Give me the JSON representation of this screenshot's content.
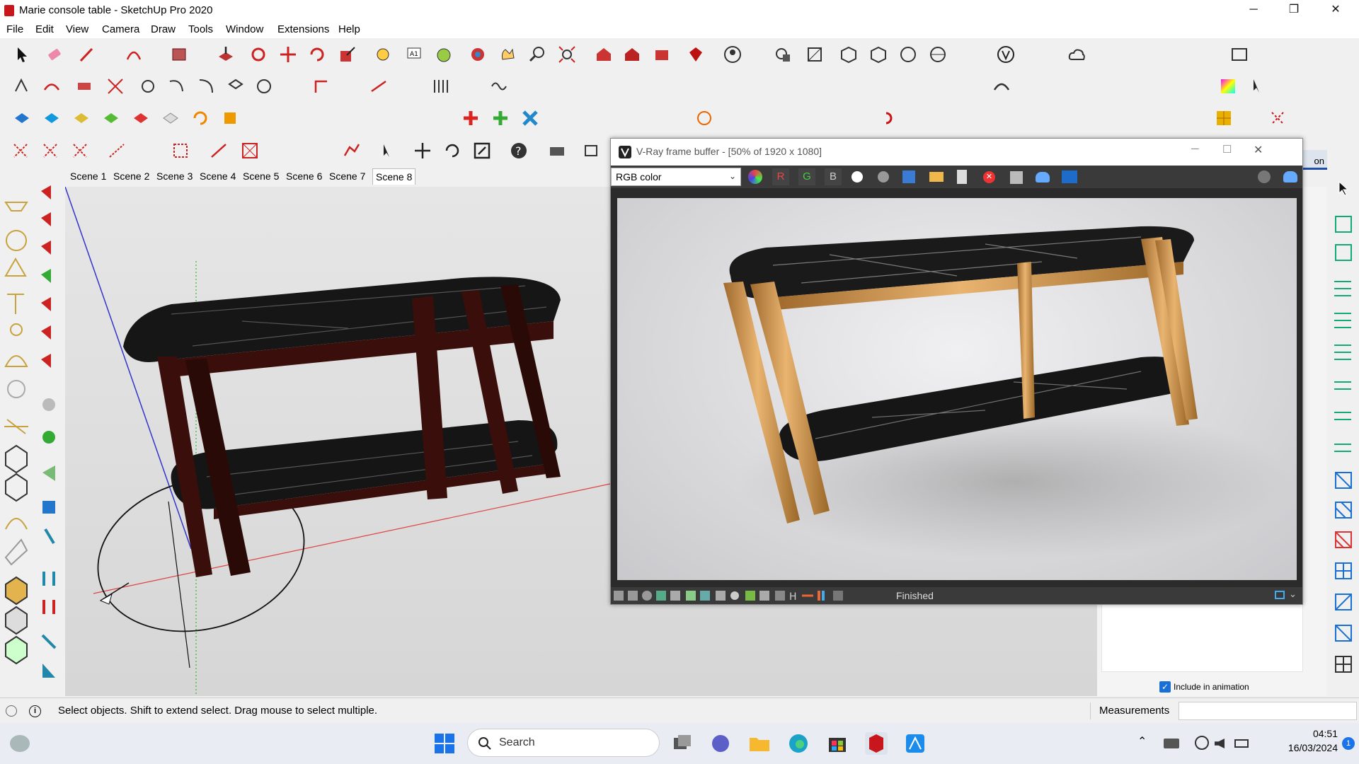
{
  "window": {
    "title": "Marie console table - SketchUp Pro 2020"
  },
  "menu": [
    "File",
    "Edit",
    "View",
    "Camera",
    "Draw",
    "Tools",
    "Window",
    "Extensions",
    "Help"
  ],
  "scenes": [
    "Scene 1",
    "Scene 2",
    "Scene 3",
    "Scene 4",
    "Scene 5",
    "Scene 6",
    "Scene 7",
    "Scene 8"
  ],
  "vfb": {
    "title": "V-Ray frame buffer - [50% of 1920 x 1080]",
    "channel": "RGB color",
    "status": "Finished",
    "rgb_buttons": [
      "R",
      "G",
      "B"
    ]
  },
  "tray": {
    "tab_fragment": "on",
    "include_animation": "Include in animation"
  },
  "status": {
    "hint": "Select objects. Shift to extend select. Drag mouse to select multiple.",
    "measurements_label": "Measurements"
  },
  "taskbar": {
    "search_placeholder": "Search",
    "time": "04:51",
    "date": "16/03/2024"
  },
  "colors": {
    "sketchup_red": "#c8161d",
    "vray_dark": "#3a3a3a",
    "axis_red": "#d44",
    "axis_green": "#3b3",
    "axis_blue": "#33c"
  }
}
